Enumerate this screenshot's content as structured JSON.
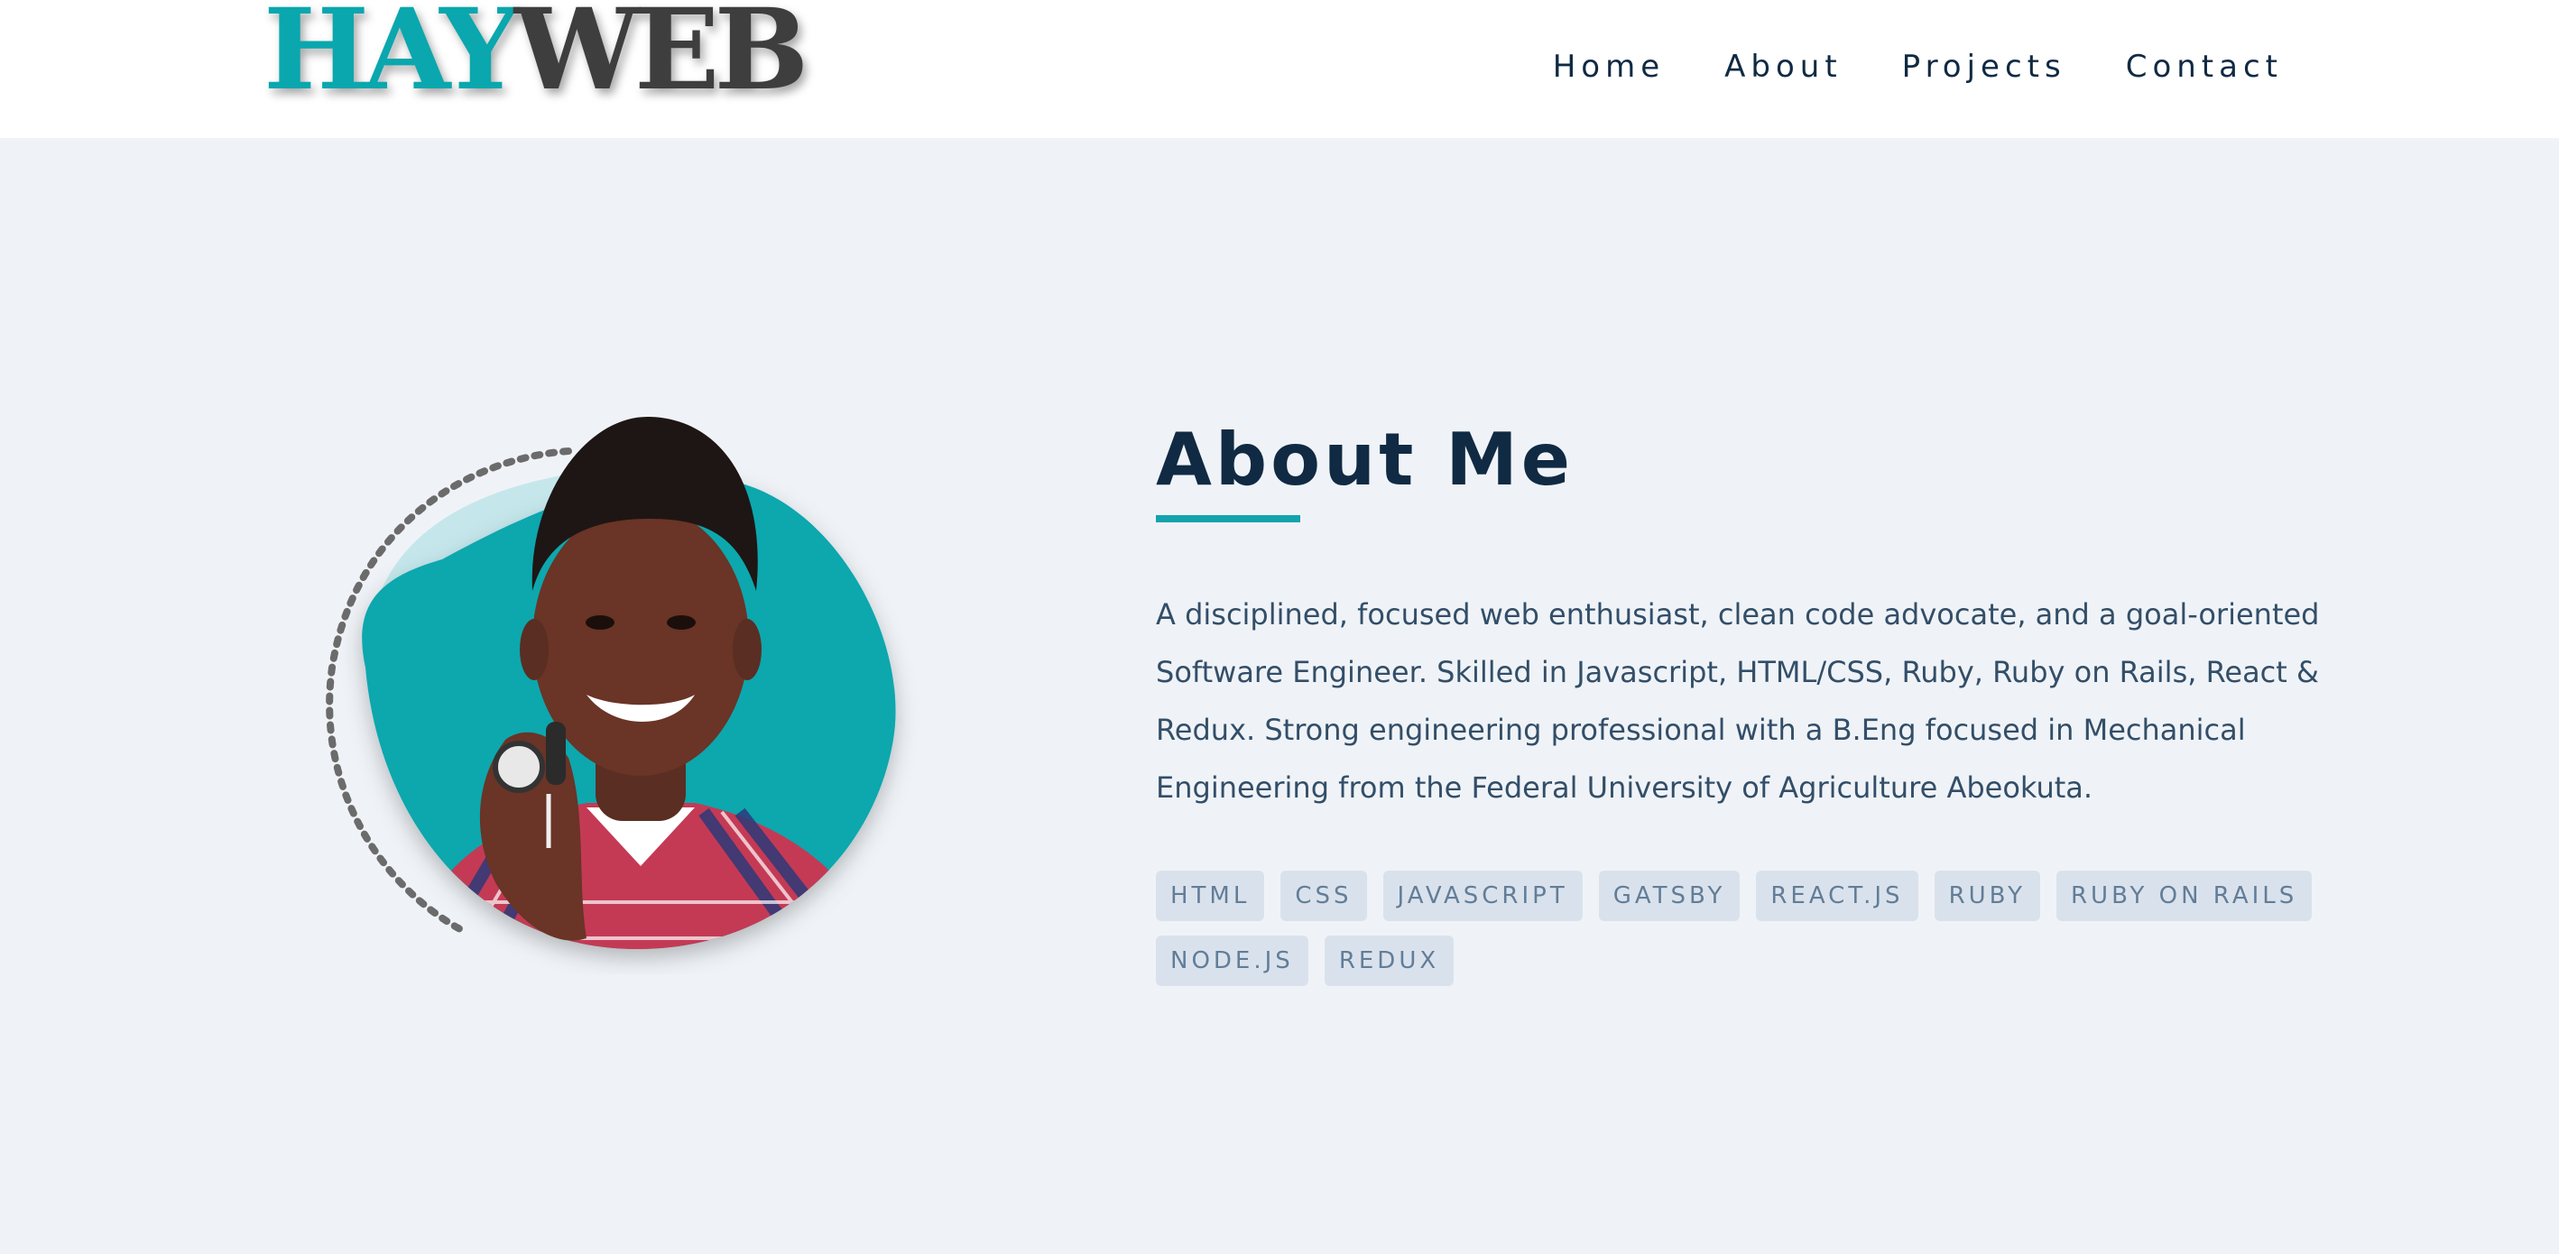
{
  "header": {
    "logo": {
      "part1": "HAY",
      "part2": "WEB"
    },
    "nav": [
      "Home",
      "About",
      "Projects",
      "Contact"
    ]
  },
  "about": {
    "title": "About Me",
    "description": "A disciplined, focused web enthusiast, clean code advocate, and a goal-oriented Software Engineer. Skilled in Javascript, HTML/CSS, Ruby, Ruby on Rails, React & Redux. Strong engineering professional with a B.Eng focused in Mechanical Engineering from the Federal University of Agriculture Abeokuta.",
    "skills": [
      "HTML",
      "CSS",
      "JAVASCRIPT",
      "GATSBY",
      "REACT.JS",
      "RUBY",
      "RUBY ON RAILS",
      "NODE.JS",
      "REDUX"
    ]
  },
  "colors": {
    "accent": "#0aa7ae",
    "accent_light": "#c5e7ec",
    "dark": "#102a43",
    "logo_dark": "#3e3e3e",
    "tag_bg": "#d9e2ec",
    "tag_text": "#627d98",
    "page_bg": "#eff3f7"
  }
}
